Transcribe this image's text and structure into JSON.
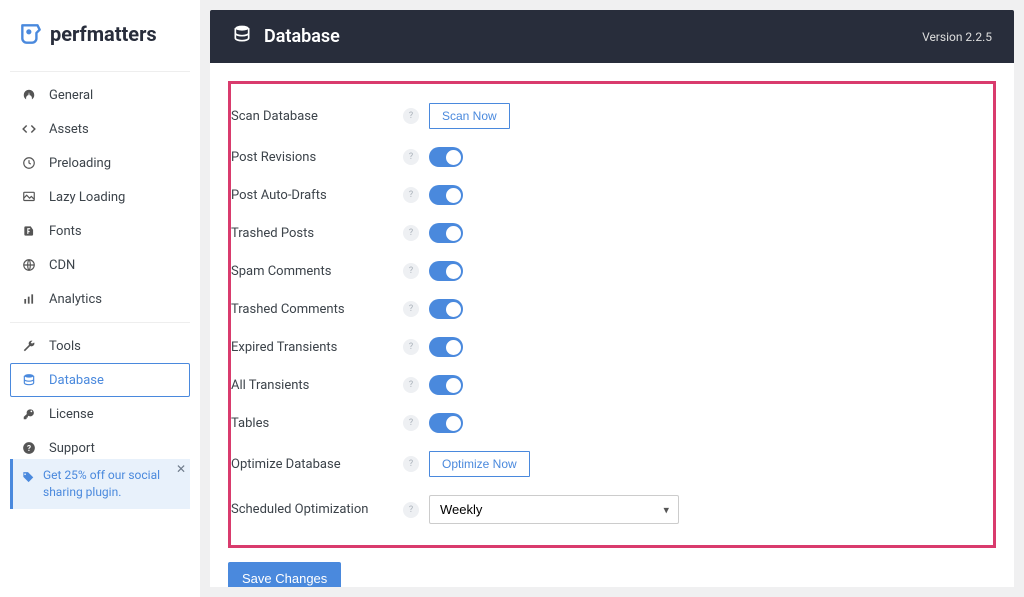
{
  "brand": "perfmatters",
  "sidebar": {
    "group1": [
      {
        "label": "General"
      },
      {
        "label": "Assets"
      },
      {
        "label": "Preloading"
      },
      {
        "label": "Lazy Loading"
      },
      {
        "label": "Fonts"
      },
      {
        "label": "CDN"
      },
      {
        "label": "Analytics"
      }
    ],
    "group2": [
      {
        "label": "Tools"
      },
      {
        "label": "Database"
      },
      {
        "label": "License"
      },
      {
        "label": "Support"
      }
    ]
  },
  "promo": {
    "text": "Get 25% off our social sharing plugin."
  },
  "header": {
    "title": "Database",
    "version": "Version 2.2.5"
  },
  "rows": {
    "scan_database": "Scan Database",
    "scan_now": "Scan Now",
    "post_revisions": "Post Revisions",
    "post_auto_drafts": "Post Auto-Drafts",
    "trashed_posts": "Trashed Posts",
    "spam_comments": "Spam Comments",
    "trashed_comments": "Trashed Comments",
    "expired_transients": "Expired Transients",
    "all_transients": "All Transients",
    "tables": "Tables",
    "optimize_database": "Optimize Database",
    "optimize_now": "Optimize Now",
    "scheduled_optimization": "Scheduled Optimization",
    "scheduled_value": "Weekly"
  },
  "save_button": "Save Changes"
}
